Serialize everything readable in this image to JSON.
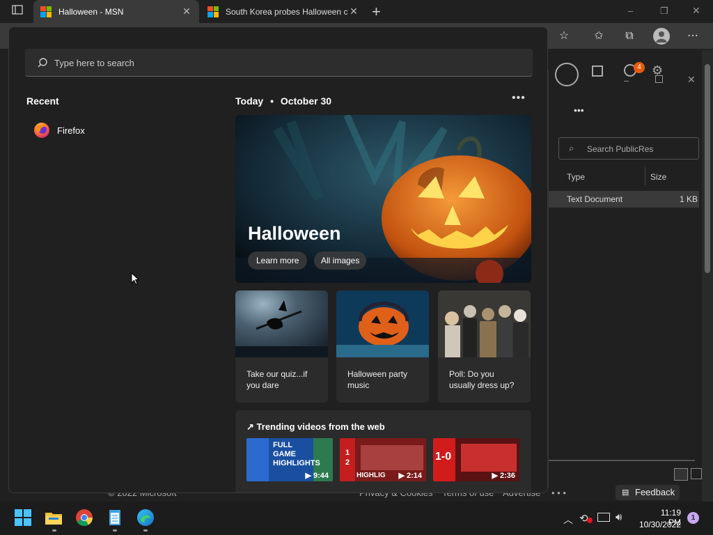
{
  "browser": {
    "tabs": [
      {
        "title": "Halloween - MSN",
        "active": true
      },
      {
        "title": "South Korea probes Halloween c",
        "active": false
      }
    ],
    "new_tab": "+",
    "window_controls": [
      "–",
      "❐",
      "✕"
    ]
  },
  "background_window": {
    "search_placeholder": "Search PublicRes",
    "columns": [
      "Type",
      "Size"
    ],
    "row": {
      "type": "Text Document",
      "size": "1 KB"
    },
    "menu_dots": "•••"
  },
  "page_footer": {
    "copyright": "© 2022 Microsoft",
    "links": [
      "Privacy & Cookies",
      "Terms of use",
      "Advertise"
    ],
    "feedback": "Feedback"
  },
  "start_menu": {
    "search_placeholder": "Type here to search",
    "recent_heading": "Recent",
    "recent_items": [
      {
        "label": "Firefox",
        "icon": "firefox-icon"
      }
    ],
    "today_heading": "Today",
    "today_date": "October 30",
    "more": "•••",
    "hero": {
      "title": "Halloween",
      "buttons": [
        "Learn more",
        "All images"
      ]
    },
    "cards": [
      {
        "caption": "Take our quiz...if you dare"
      },
      {
        "caption": "Halloween party music"
      },
      {
        "caption": "Poll: Do you usually dress up?"
      }
    ],
    "trending": {
      "heading": "Trending videos from the web",
      "videos": [
        {
          "overlay": "FULL GAME HIGHLIGHTS",
          "duration": "9:44"
        },
        {
          "overlay": "HIGHLIG",
          "duration": "2:14"
        },
        {
          "overlay": "1-0",
          "duration": "2:36"
        }
      ]
    }
  },
  "taskbar": {
    "time": "11:19 PM",
    "date": "10/30/2022",
    "notification_count": "1",
    "badge_count": "4"
  },
  "colors": {
    "accent": "#0a84ff",
    "pumpkin": "#e8761b"
  }
}
